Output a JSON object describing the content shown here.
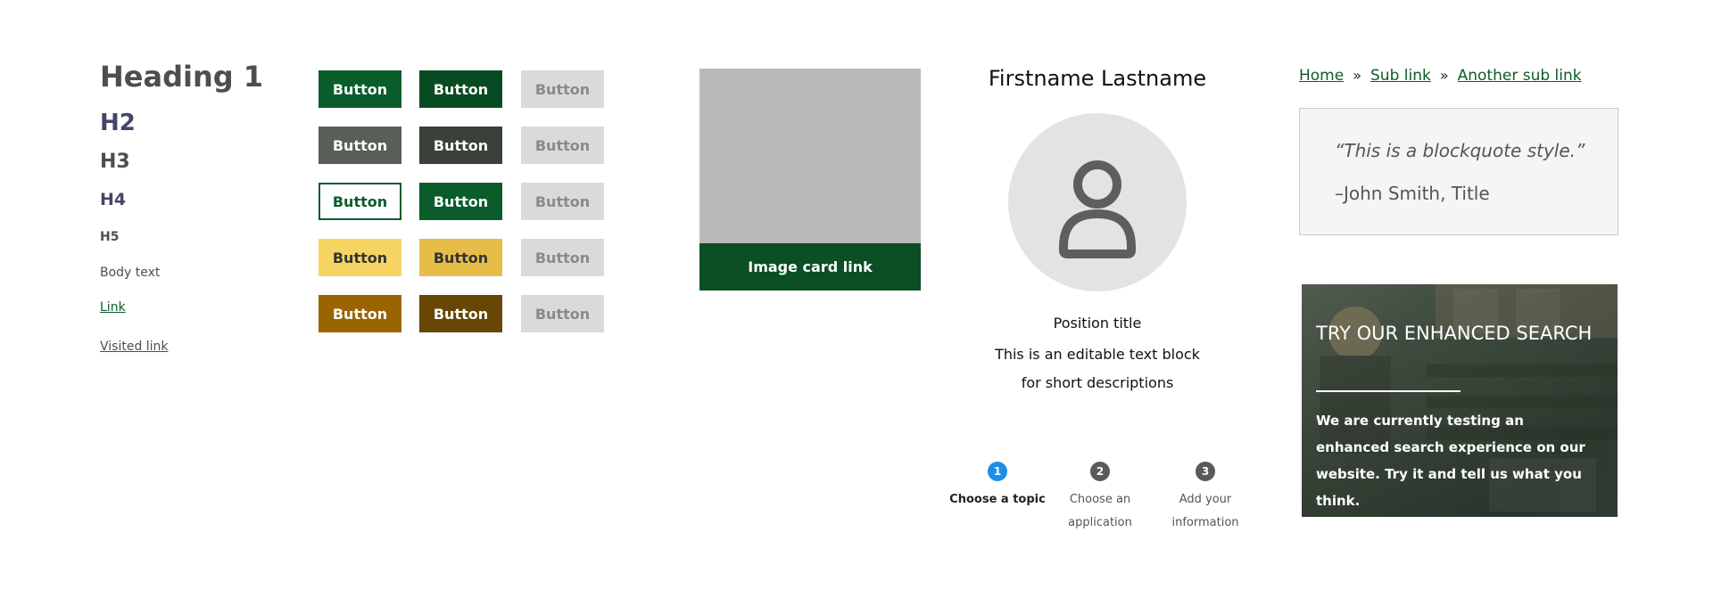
{
  "typography": {
    "heading1": "Heading 1",
    "h2": "H2",
    "h3": "H3",
    "h4": "H4",
    "h5": "H5",
    "body_text": "Body text",
    "link": "Link",
    "visited_link": "Visited link"
  },
  "buttons": {
    "label": "Button",
    "rows": [
      [
        "primary-green",
        "primary-green-hover",
        "disabled"
      ],
      [
        "secondary-gray",
        "secondary-gray-hover",
        "disabled"
      ],
      [
        "outline-green",
        "outline-green-hover",
        "disabled"
      ],
      [
        "yellow",
        "yellow-hover",
        "disabled"
      ],
      [
        "gold",
        "gold-hover",
        "disabled"
      ]
    ]
  },
  "image_card": {
    "link_label": "Image card link"
  },
  "profile": {
    "name": "Firstname Lastname",
    "avatar_icon": "user-icon",
    "position_title": "Position title",
    "description_line1": "This is an editable text block",
    "description_line2": "for short descriptions"
  },
  "stepper": {
    "steps": [
      {
        "number": "1",
        "label": "Choose a topic",
        "active": true
      },
      {
        "number": "2",
        "label_line1": "Choose an",
        "label_line2": "application",
        "active": false
      },
      {
        "number": "3",
        "label_line1": "Add your",
        "label_line2": "information",
        "active": false
      }
    ]
  },
  "breadcrumb": {
    "items": [
      "Home",
      "Sub link",
      "Another sub link"
    ],
    "separator": "»"
  },
  "blockquote": {
    "text": "“This is a blockquote style.”",
    "author": "–John Smith, Title"
  },
  "search_banner": {
    "title": "TRY OUR ENHANCED SEARCH",
    "body": "We are currently testing an enhanced search experience on our website. Try it and tell us what you think."
  },
  "colors": {
    "brand_green": "#0b5c2b",
    "dark_green": "#0b4f24",
    "step_active": "#1e8fe8",
    "step_inactive": "#5a5a5a"
  }
}
